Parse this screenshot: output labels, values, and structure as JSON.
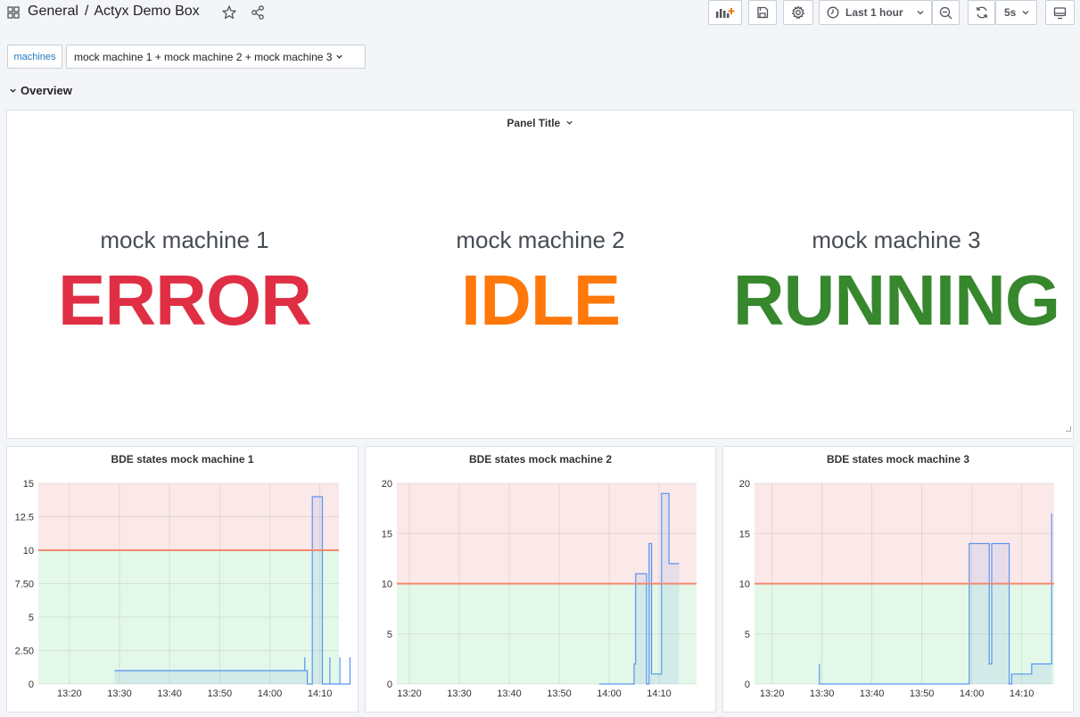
{
  "header": {
    "folder": "General",
    "separator": "/",
    "dashboard": "Actyx Demo Box",
    "time_range": "Last 1 hour",
    "refresh": "5s"
  },
  "variables": {
    "label": "machines",
    "value": "mock machine 1 + mock machine 2 + mock machine 3"
  },
  "row": {
    "title": "Overview"
  },
  "status_panel": {
    "title": "Panel Title",
    "items": [
      {
        "name": "mock machine 1",
        "state": "ERROR",
        "color": "#e02f44"
      },
      {
        "name": "mock machine 2",
        "state": "IDLE",
        "color": "#ff780a"
      },
      {
        "name": "mock machine 3",
        "state": "RUNNING",
        "color": "#37872d"
      }
    ]
  },
  "colors": {
    "threshold_line": "#f2896f",
    "critical_fill": "#fbe8e8",
    "ok_fill": "#e3f8e8",
    "series": "#5794f2"
  },
  "chart_data": [
    {
      "type": "line",
      "title": "BDE states mock machine 1",
      "x_ticks": [
        "13:20",
        "13:30",
        "13:40",
        "13:50",
        "14:00",
        "14:10"
      ],
      "y_ticks": [
        "0",
        "2.50",
        "5",
        "7.50",
        "10",
        "12.5",
        "15"
      ],
      "ylim": [
        0,
        15
      ],
      "xlim_minutes": [
        13.8,
        73.8
      ],
      "threshold": 10,
      "x": [
        "13:29",
        "14:07",
        "14:07",
        "14:07",
        "14:07.5",
        "14:07.5",
        "14:08",
        "14:08.5",
        "14:08.5",
        "14:10.5",
        "14:10.5",
        "14:12",
        "14:12",
        "14:12",
        "14:14",
        "14:14",
        "14:14",
        "14:16",
        "14:16",
        "14:16"
      ],
      "values": [
        1,
        1,
        2,
        1,
        1,
        0,
        0,
        0,
        14,
        14,
        0,
        0,
        2,
        0,
        0,
        2,
        0,
        0,
        2,
        0
      ]
    },
    {
      "type": "line",
      "title": "BDE states mock machine 2",
      "x_ticks": [
        "13:20",
        "13:30",
        "13:40",
        "13:50",
        "14:00",
        "14:10"
      ],
      "y_ticks": [
        "0",
        "5",
        "10",
        "15",
        "20"
      ],
      "ylim": [
        0,
        20
      ],
      "xlim_minutes": [
        17.5,
        77.5
      ],
      "threshold": 10,
      "x": [
        "13:58",
        "14:05",
        "14:05",
        "14:05.3",
        "14:05.3",
        "14:07.5",
        "14:07.5",
        "14:08",
        "14:08",
        "14:08.5",
        "14:08.5",
        "14:10.5",
        "14:10.5",
        "14:12",
        "14:12",
        "14:14"
      ],
      "values": [
        0,
        0,
        2,
        2,
        11,
        11,
        0,
        0,
        14,
        14,
        1,
        1,
        19,
        19,
        12,
        12
      ]
    },
    {
      "type": "line",
      "title": "BDE states mock machine 3",
      "x_ticks": [
        "13:20",
        "13:30",
        "13:40",
        "13:50",
        "14:00",
        "14:10"
      ],
      "y_ticks": [
        "0",
        "5",
        "10",
        "15",
        "20"
      ],
      "ylim": [
        0,
        20
      ],
      "xlim_minutes": [
        16.5,
        76.5
      ],
      "threshold": 10,
      "x": [
        "13:29.5",
        "13:29.5",
        "13:29.5",
        "13:59",
        "13:59.5",
        "13:59.5",
        "14:03.5",
        "14:03.5",
        "14:04",
        "14:04",
        "14:07.5",
        "14:07.5",
        "14:08",
        "14:08",
        "14:12",
        "14:12",
        "14:16",
        "14:16"
      ],
      "values": [
        2,
        0,
        0,
        0,
        0,
        14,
        14,
        2,
        2,
        14,
        14,
        0,
        0,
        1,
        1,
        2,
        2,
        17
      ]
    }
  ]
}
